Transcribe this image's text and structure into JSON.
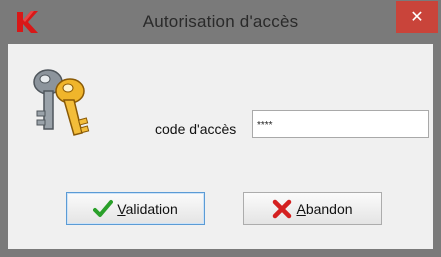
{
  "window": {
    "title": "Autorisation d'accès",
    "close_glyph": "✕",
    "colors": {
      "titlebar": "#7a7a7a",
      "close": "#c9443a",
      "client": "#f0f0f0"
    }
  },
  "form": {
    "label": "code d'accès",
    "code_value": "****"
  },
  "buttons": {
    "validation": {
      "label": "Validation",
      "icon": "green-checkmark-icon"
    },
    "abandon": {
      "label": "Abandon",
      "icon": "red-x-icon"
    }
  }
}
